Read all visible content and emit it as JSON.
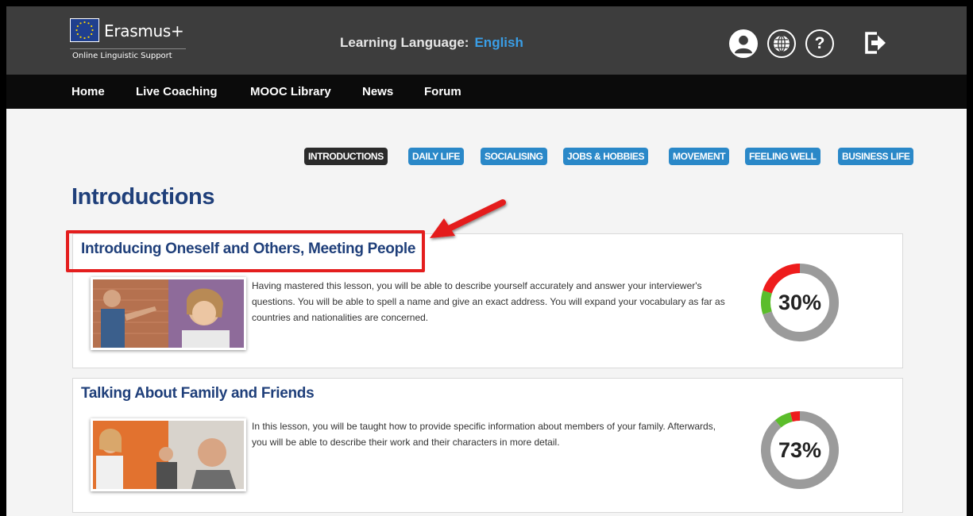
{
  "header": {
    "brand_name": "Erasmus+",
    "brand_subtitle": "Online Linguistic Support",
    "learning_language_label": "Learning Language:",
    "learning_language_value": "English",
    "icons": [
      "eu-flag-icon",
      "profile-icon",
      "globe-icon",
      "help-icon",
      "logout-icon"
    ],
    "help_glyph": "?"
  },
  "nav": {
    "items": [
      "Home",
      "Live Coaching",
      "MOOC Library",
      "News",
      "Forum"
    ]
  },
  "categories": {
    "items": [
      "INTRODUCTIONS",
      "DAILY LIFE",
      "SOCIALISING",
      "JOBS & HOBBIES",
      "MOVEMENT",
      "FEELING WELL",
      "BUSINESS LIFE"
    ],
    "active": "INTRODUCTIONS"
  },
  "page_title": "Introductions",
  "lessons": [
    {
      "title": "Introducing Oneself and Others, Meeting People",
      "description": "Having mastered this lesson, you will be able to describe yourself accurately and answer your interviewer's questions. You will be able to spell a name and give an exact address. You will expand your vocabulary as far as countries and nationalities are concerned.",
      "progress_label": "30%",
      "progress_segments": {
        "red": 0.2,
        "green": 0.1,
        "gray": 0.7
      }
    },
    {
      "title": "Talking About Family and Friends",
      "description": "In this lesson, you will be taught how to provide specific information about members of your family. Afterwards, you will be able to describe their work and their characters in more detail.",
      "progress_label": "73%",
      "progress_segments": {
        "red": 0.04,
        "green": 0.07,
        "gray": 0.89
      }
    }
  ],
  "colors": {
    "accent_blue": "#2a88c8",
    "title_navy": "#1f3f7a",
    "progress_red": "#ee1c1c",
    "progress_green": "#5bbd2b",
    "progress_gray": "#9b9b9b",
    "annotation_red": "#e41e1e"
  }
}
